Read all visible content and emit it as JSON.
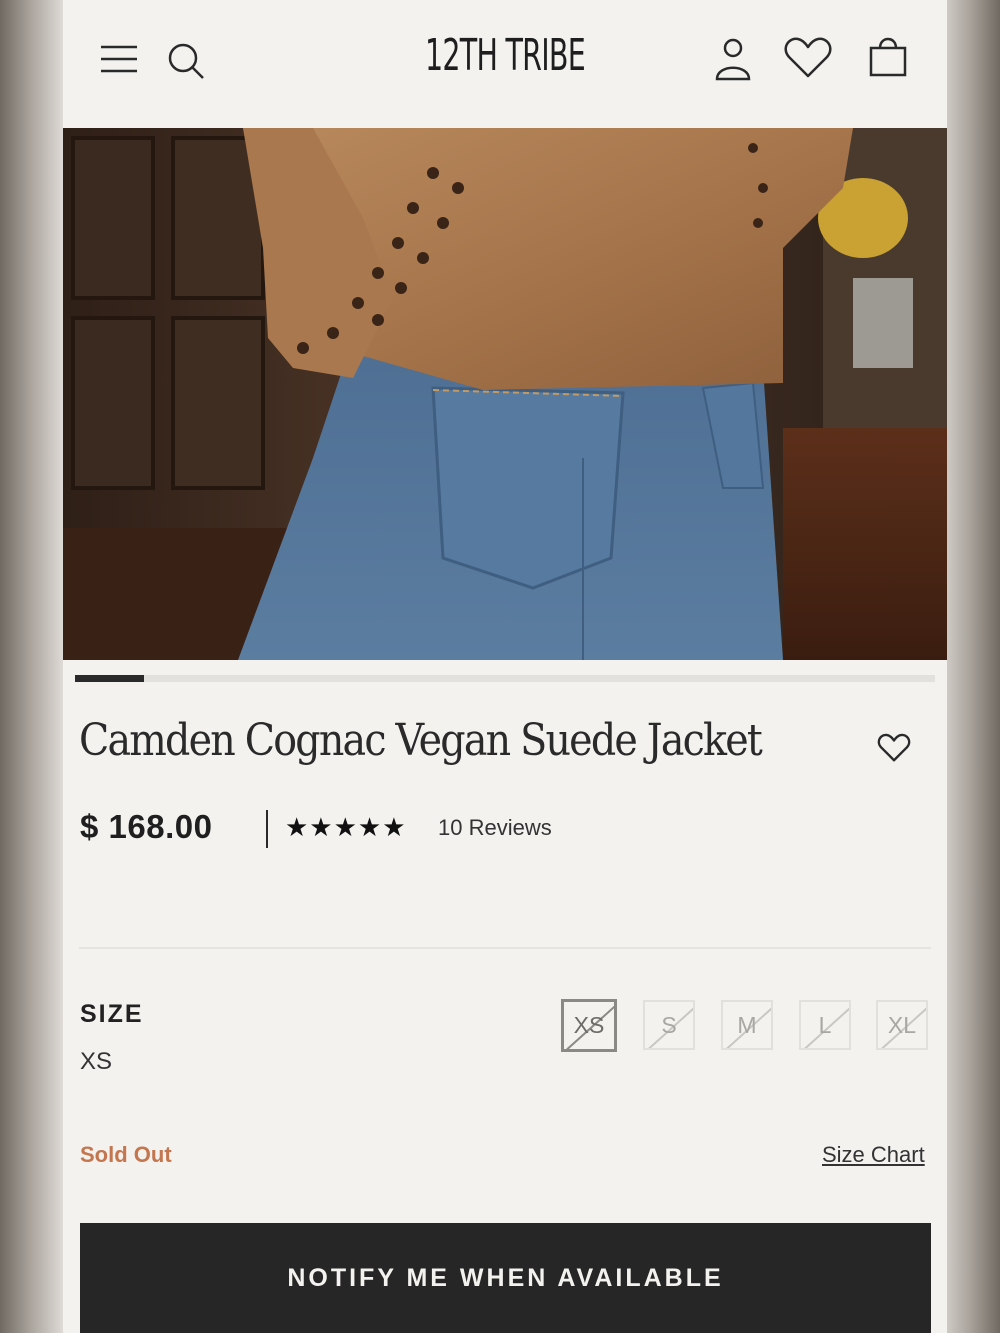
{
  "header": {
    "logo": "12TH TRIBE",
    "icons": [
      "menu-icon",
      "search-icon",
      "account-icon",
      "wishlist-icon",
      "cart-icon"
    ]
  },
  "carousel": {
    "current_slide_fraction": 0.08
  },
  "product": {
    "title": "Camden Cognac Vegan Suede Jacket",
    "price": "$ 168.00",
    "rating_stars": "★★★★★",
    "rating": 5,
    "reviews_label": "10 Reviews"
  },
  "size": {
    "label": "SIZE",
    "selected": "XS",
    "options": [
      "XS",
      "S",
      "M",
      "L",
      "XL"
    ]
  },
  "availability": {
    "status": "Sold Out",
    "status_color": "#c4764f",
    "size_chart_label": "Size Chart"
  },
  "cta": {
    "label": "NOTIFY ME WHEN AVAILABLE"
  }
}
